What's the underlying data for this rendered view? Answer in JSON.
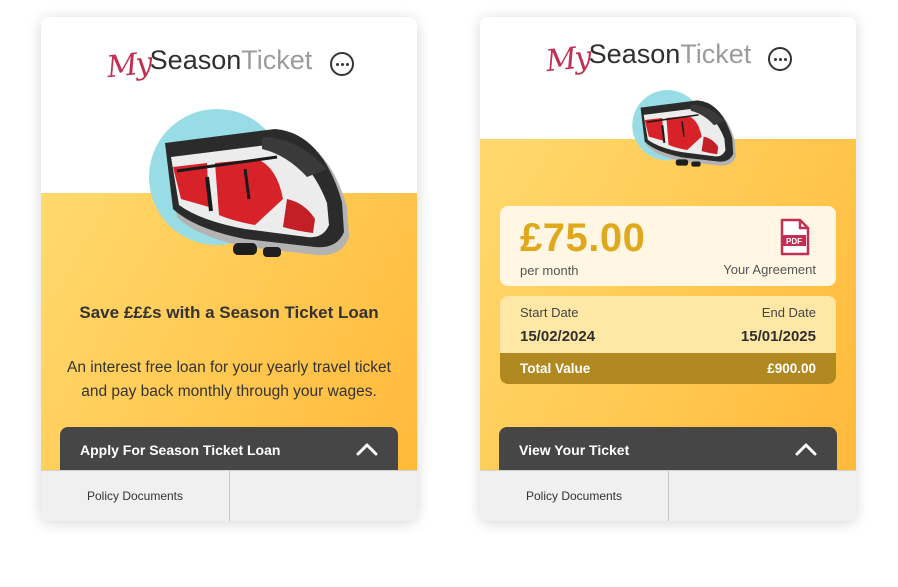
{
  "brand": {
    "my": "My",
    "season": "Season",
    "ticket": "Ticket"
  },
  "colors": {
    "accent": "#c22f52",
    "gold": "#e0a81c",
    "dark_button": "#464646",
    "total_bar": "#b08a21"
  },
  "left_card": {
    "title": "Save £££s with a Season Ticket Loan",
    "description": "An interest free loan for your yearly travel ticket and pay back monthly through your wages.",
    "action_label": "Apply For Season Ticket Loan",
    "footer_tabs": [
      "Policy Documents",
      ""
    ]
  },
  "right_card": {
    "amount": "£75.00",
    "per_month": "per month",
    "agreement_label": "Your Agreement",
    "pdf_label": "PDF",
    "start_label": "Start Date",
    "start_value": "15/02/2024",
    "end_label": "End Date",
    "end_value": "15/01/2025",
    "total_label": "Total Value",
    "total_value": "£900.00",
    "action_label": "View Your Ticket",
    "footer_tabs": [
      "Policy Documents",
      ""
    ]
  },
  "icons": {
    "menu": "more-horizontal-icon",
    "chevron": "chevron-up-icon",
    "pdf": "pdf-file-icon",
    "illustration": "train-illustration"
  }
}
